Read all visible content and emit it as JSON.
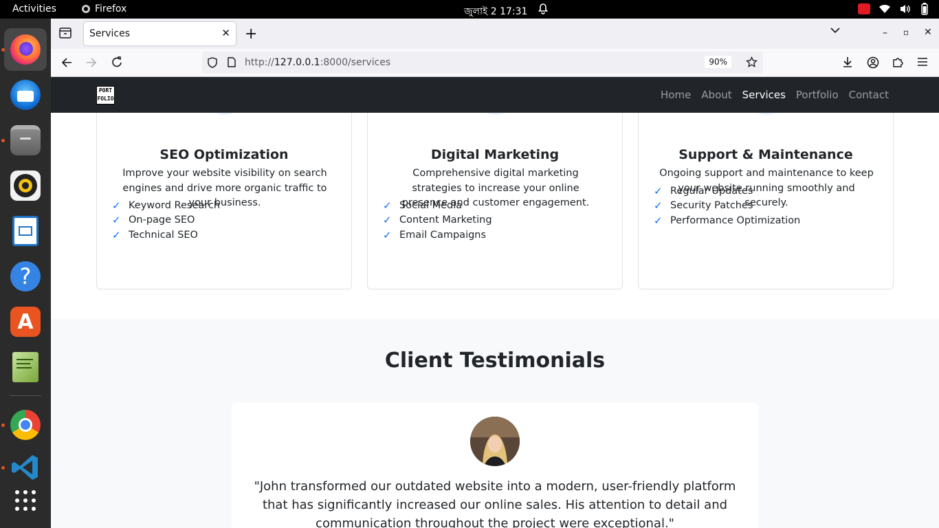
{
  "system": {
    "activities": "Activities",
    "app_name": "Firefox",
    "clock": "জুলাই 2  17:31"
  },
  "dock": {
    "apps": [
      "firefox",
      "thunderbird",
      "files",
      "rhythmbox",
      "libreoffice-impress",
      "help",
      "app-center",
      "text-editor",
      "chrome",
      "vscode",
      "show-apps"
    ]
  },
  "browser": {
    "tab_title": "Services",
    "url_prefix": "http://",
    "url_host": "127.0.0.1",
    "url_rest": ":8000/services",
    "zoom": "90%"
  },
  "site": {
    "logo_line1": "PORT",
    "logo_line2": "FOLIO",
    "nav": [
      "Home",
      "About",
      "Services",
      "Portfolio",
      "Contact"
    ],
    "active_nav": "Services",
    "accent_color": "#0d6efd",
    "cards": [
      {
        "icon": "search-icon",
        "title": "SEO Optimization",
        "description": "Improve your website visibility on search engines and drive more organic traffic to your business.",
        "features": [
          "Keyword Research",
          "On-page SEO",
          "Technical SEO"
        ]
      },
      {
        "icon": "megaphone-icon",
        "title": "Digital Marketing",
        "description": "Comprehensive digital marketing strategies to increase your online presence and customer engagement.",
        "features": [
          "Social Media",
          "Content Marketing",
          "Email Campaigns"
        ]
      },
      {
        "icon": "tools-icon",
        "title": "Support & Maintenance",
        "description": "Ongoing support and maintenance to keep your website running smoothly and securely.",
        "features": [
          "Regular Updates",
          "Security Patches",
          "Performance Optimization"
        ]
      }
    ],
    "testimonials": {
      "heading": "Client Testimonials",
      "quote": "\"John transformed our outdated website into a modern, user-friendly platform that has significantly increased our online sales. His attention to detail and communication throughout the project were exceptional.\""
    }
  }
}
